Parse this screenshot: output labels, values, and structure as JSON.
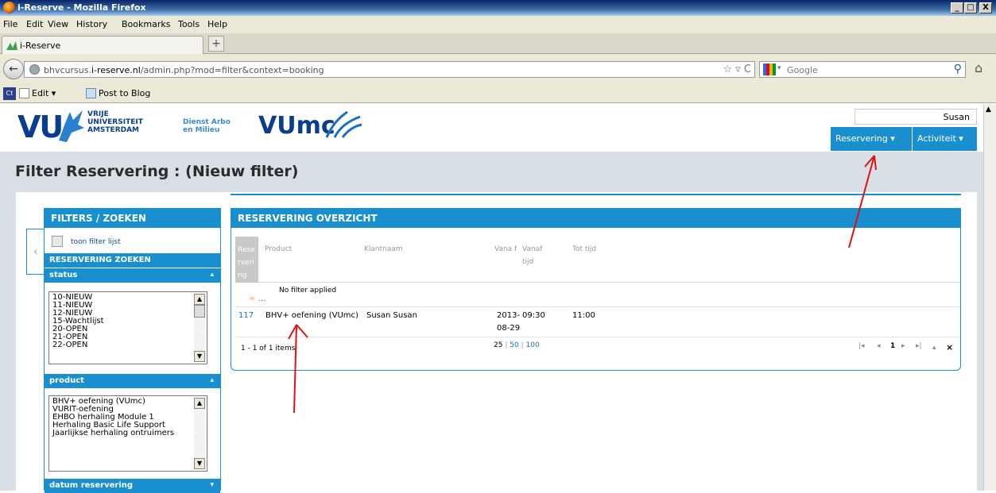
{
  "window": {
    "title": "i-Reserve - Mozilla Firefox",
    "buttons": [
      "_",
      "□",
      "X"
    ]
  },
  "menu": [
    "File",
    "Edit",
    "View",
    "History",
    "Bookmarks",
    "Tools",
    "Help"
  ],
  "tab": {
    "label": "i-Reserve",
    "new_tab": "+"
  },
  "nav": {
    "url_pre": "bhvcursus.",
    "url_host": "i-reserve.nl",
    "url_post": "/admin.php?mod=filter&context=booking",
    "search_placeholder": "Google"
  },
  "bookmarks": {
    "ct": "Ct",
    "edit": "Edit",
    "post": "Post to Blog"
  },
  "header": {
    "logo": "VU",
    "uni_lines": [
      "VRIJE",
      "UNIVERSITEIT",
      "AMSTERDAM"
    ],
    "dienst_lines": [
      "Dienst Arbo",
      "en Milieu"
    ],
    "vumc": "VUmc",
    "user": "Susan",
    "nav": [
      {
        "label": "Reservering ▾"
      },
      {
        "label": "Activiteit ▾"
      }
    ]
  },
  "page_title": "Filter Reservering : (Nieuw filter)",
  "left_panel": {
    "title": "FILTERS / ZOEKEN",
    "show_filter": "toon filter lijst",
    "search_title": "RESERVERING ZOEKEN",
    "status_title": "status",
    "status_options": [
      "10-NIEUW",
      "11-NIEUW",
      "12-NIEUW",
      "15-Wachtlijst",
      "20-OPEN",
      "21-OPEN",
      "22-OPEN"
    ],
    "product_title": "product",
    "product_options": [
      "BHV+ oefening (VUmc)",
      "VURIT-oefening",
      "EHBO herhaling Module 1",
      "Herhaling Basic Life Support",
      "Jaarlijkse herhaling ontruimers"
    ],
    "date_title": "datum reservering"
  },
  "right_panel": {
    "title": "RESERVERING OVERZICHT",
    "columns": {
      "id": "Rese rveri ng ID",
      "product": "Product",
      "client": "Klantnaam",
      "from": "Vana f",
      "from_time": "Vanaf tijd",
      "to_time": "Tot tijd"
    },
    "filter_msg": "No filter applied",
    "rows": [
      {
        "id": "117",
        "product": "BHV+ oefening (VUmc)",
        "client": "Susan Susan",
        "date1": "2013-",
        "date2": "08-29",
        "from_time": "09:30",
        "to_time": "11:00"
      }
    ],
    "items": "1 - 1 of 1 items",
    "page_sizes": {
      "a": "25",
      "b": "50",
      "c": "100"
    },
    "page_num": "1"
  },
  "colors": {
    "accent": "#1a8fd0",
    "annotation": "#e01010"
  }
}
